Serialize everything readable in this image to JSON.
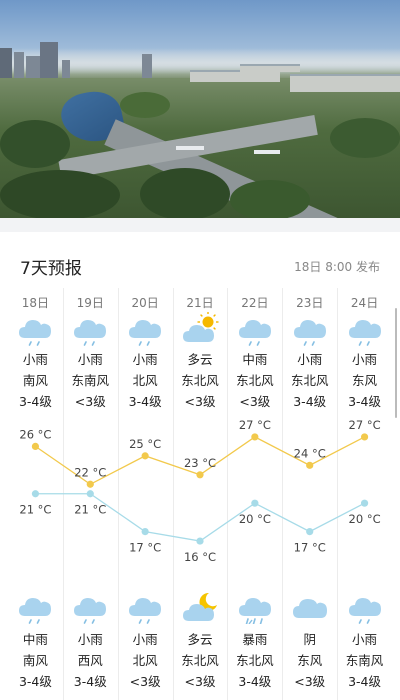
{
  "header": {
    "section_title": "7天预报",
    "publish_time": "18日 8:00 发布"
  },
  "colors": {
    "high_line": "#f2c94c",
    "low_line": "#a7dbe8",
    "cloud": "#a9d3ee",
    "cloud_dark": "#86bfe3",
    "sun": "#f5b800",
    "moon": "#f5c400",
    "grid_line": "#ececec"
  },
  "days": [
    {
      "date": "18日",
      "day_icon": "cloud-rain-icon",
      "day_cond": "小雨",
      "day_wind_dir": "南风",
      "day_wind_lvl": "3-4级",
      "high": "26 °C",
      "low": "21 °C",
      "night_icon": "cloud-rain-icon",
      "night_cond": "中雨",
      "night_wind_dir": "南风",
      "night_wind_lvl": "3-4级"
    },
    {
      "date": "19日",
      "day_icon": "cloud-rain-icon",
      "day_cond": "小雨",
      "day_wind_dir": "东南风",
      "day_wind_lvl": "<3级",
      "high": "22 °C",
      "low": "21 °C",
      "night_icon": "cloud-rain-icon",
      "night_cond": "小雨",
      "night_wind_dir": "西风",
      "night_wind_lvl": "3-4级"
    },
    {
      "date": "20日",
      "day_icon": "cloud-rain-icon",
      "day_cond": "小雨",
      "day_wind_dir": "北风",
      "day_wind_lvl": "3-4级",
      "high": "25 °C",
      "low": "17 °C",
      "night_icon": "cloud-rain-icon",
      "night_cond": "小雨",
      "night_wind_dir": "北风",
      "night_wind_lvl": "<3级"
    },
    {
      "date": "21日",
      "day_icon": "cloud-sun-icon",
      "day_cond": "多云",
      "day_wind_dir": "东北风",
      "day_wind_lvl": "<3级",
      "high": "23 °C",
      "low": "16 °C",
      "night_icon": "cloud-moon-icon",
      "night_cond": "多云",
      "night_wind_dir": "东北风",
      "night_wind_lvl": "<3级"
    },
    {
      "date": "22日",
      "day_icon": "cloud-rain-icon",
      "day_cond": "中雨",
      "day_wind_dir": "东北风",
      "day_wind_lvl": "<3级",
      "high": "27 °C",
      "low": "20 °C",
      "night_icon": "cloud-heavy-rain-icon",
      "night_cond": "暴雨",
      "night_wind_dir": "东北风",
      "night_wind_lvl": "3-4级"
    },
    {
      "date": "23日",
      "day_icon": "cloud-rain-icon",
      "day_cond": "小雨",
      "day_wind_dir": "东北风",
      "day_wind_lvl": "3-4级",
      "high": "24 °C",
      "low": "17 °C",
      "night_icon": "cloud-icon",
      "night_cond": "阴",
      "night_wind_dir": "东风",
      "night_wind_lvl": "<3级"
    },
    {
      "date": "24日",
      "day_icon": "cloud-rain-icon",
      "day_cond": "小雨",
      "day_wind_dir": "东风",
      "day_wind_lvl": "3-4级",
      "high": "27 °C",
      "low": "20 °C",
      "night_icon": "cloud-rain-icon",
      "night_cond": "小雨",
      "night_wind_dir": "东南风",
      "night_wind_lvl": "3-4级"
    }
  ],
  "chart_data": {
    "type": "line",
    "categories": [
      "18日",
      "19日",
      "20日",
      "21日",
      "22日",
      "23日",
      "24日"
    ],
    "series": [
      {
        "values": [
          26,
          22,
          25,
          23,
          27,
          24,
          27
        ]
      },
      {
        "values": [
          21,
          21,
          17,
          16,
          20,
          17,
          20
        ]
      }
    ],
    "ylim": [
      14,
      29
    ],
    "grid": false
  }
}
